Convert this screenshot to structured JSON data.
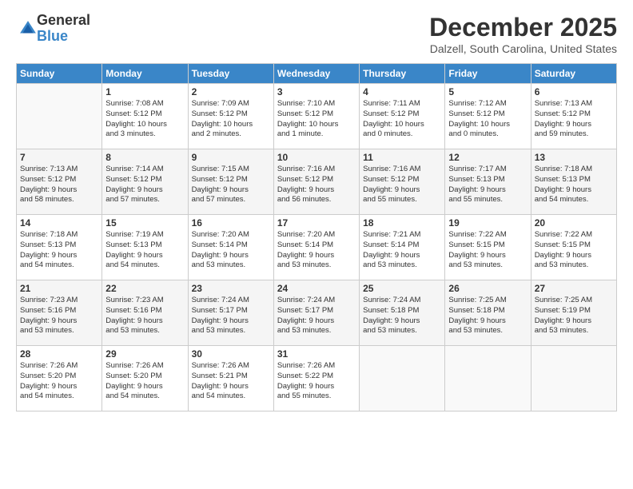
{
  "logo": {
    "general": "General",
    "blue": "Blue"
  },
  "header": {
    "month": "December 2025",
    "location": "Dalzell, South Carolina, United States"
  },
  "weekdays": [
    "Sunday",
    "Monday",
    "Tuesday",
    "Wednesday",
    "Thursday",
    "Friday",
    "Saturday"
  ],
  "weeks": [
    [
      {
        "day": "",
        "info": ""
      },
      {
        "day": "1",
        "info": "Sunrise: 7:08 AM\nSunset: 5:12 PM\nDaylight: 10 hours\nand 3 minutes."
      },
      {
        "day": "2",
        "info": "Sunrise: 7:09 AM\nSunset: 5:12 PM\nDaylight: 10 hours\nand 2 minutes."
      },
      {
        "day": "3",
        "info": "Sunrise: 7:10 AM\nSunset: 5:12 PM\nDaylight: 10 hours\nand 1 minute."
      },
      {
        "day": "4",
        "info": "Sunrise: 7:11 AM\nSunset: 5:12 PM\nDaylight: 10 hours\nand 0 minutes."
      },
      {
        "day": "5",
        "info": "Sunrise: 7:12 AM\nSunset: 5:12 PM\nDaylight: 10 hours\nand 0 minutes."
      },
      {
        "day": "6",
        "info": "Sunrise: 7:13 AM\nSunset: 5:12 PM\nDaylight: 9 hours\nand 59 minutes."
      }
    ],
    [
      {
        "day": "7",
        "info": "Sunrise: 7:13 AM\nSunset: 5:12 PM\nDaylight: 9 hours\nand 58 minutes."
      },
      {
        "day": "8",
        "info": "Sunrise: 7:14 AM\nSunset: 5:12 PM\nDaylight: 9 hours\nand 57 minutes."
      },
      {
        "day": "9",
        "info": "Sunrise: 7:15 AM\nSunset: 5:12 PM\nDaylight: 9 hours\nand 57 minutes."
      },
      {
        "day": "10",
        "info": "Sunrise: 7:16 AM\nSunset: 5:12 PM\nDaylight: 9 hours\nand 56 minutes."
      },
      {
        "day": "11",
        "info": "Sunrise: 7:16 AM\nSunset: 5:12 PM\nDaylight: 9 hours\nand 55 minutes."
      },
      {
        "day": "12",
        "info": "Sunrise: 7:17 AM\nSunset: 5:13 PM\nDaylight: 9 hours\nand 55 minutes."
      },
      {
        "day": "13",
        "info": "Sunrise: 7:18 AM\nSunset: 5:13 PM\nDaylight: 9 hours\nand 54 minutes."
      }
    ],
    [
      {
        "day": "14",
        "info": "Sunrise: 7:18 AM\nSunset: 5:13 PM\nDaylight: 9 hours\nand 54 minutes."
      },
      {
        "day": "15",
        "info": "Sunrise: 7:19 AM\nSunset: 5:13 PM\nDaylight: 9 hours\nand 54 minutes."
      },
      {
        "day": "16",
        "info": "Sunrise: 7:20 AM\nSunset: 5:14 PM\nDaylight: 9 hours\nand 53 minutes."
      },
      {
        "day": "17",
        "info": "Sunrise: 7:20 AM\nSunset: 5:14 PM\nDaylight: 9 hours\nand 53 minutes."
      },
      {
        "day": "18",
        "info": "Sunrise: 7:21 AM\nSunset: 5:14 PM\nDaylight: 9 hours\nand 53 minutes."
      },
      {
        "day": "19",
        "info": "Sunrise: 7:22 AM\nSunset: 5:15 PM\nDaylight: 9 hours\nand 53 minutes."
      },
      {
        "day": "20",
        "info": "Sunrise: 7:22 AM\nSunset: 5:15 PM\nDaylight: 9 hours\nand 53 minutes."
      }
    ],
    [
      {
        "day": "21",
        "info": "Sunrise: 7:23 AM\nSunset: 5:16 PM\nDaylight: 9 hours\nand 53 minutes."
      },
      {
        "day": "22",
        "info": "Sunrise: 7:23 AM\nSunset: 5:16 PM\nDaylight: 9 hours\nand 53 minutes."
      },
      {
        "day": "23",
        "info": "Sunrise: 7:24 AM\nSunset: 5:17 PM\nDaylight: 9 hours\nand 53 minutes."
      },
      {
        "day": "24",
        "info": "Sunrise: 7:24 AM\nSunset: 5:17 PM\nDaylight: 9 hours\nand 53 minutes."
      },
      {
        "day": "25",
        "info": "Sunrise: 7:24 AM\nSunset: 5:18 PM\nDaylight: 9 hours\nand 53 minutes."
      },
      {
        "day": "26",
        "info": "Sunrise: 7:25 AM\nSunset: 5:18 PM\nDaylight: 9 hours\nand 53 minutes."
      },
      {
        "day": "27",
        "info": "Sunrise: 7:25 AM\nSunset: 5:19 PM\nDaylight: 9 hours\nand 53 minutes."
      }
    ],
    [
      {
        "day": "28",
        "info": "Sunrise: 7:26 AM\nSunset: 5:20 PM\nDaylight: 9 hours\nand 54 minutes."
      },
      {
        "day": "29",
        "info": "Sunrise: 7:26 AM\nSunset: 5:20 PM\nDaylight: 9 hours\nand 54 minutes."
      },
      {
        "day": "30",
        "info": "Sunrise: 7:26 AM\nSunset: 5:21 PM\nDaylight: 9 hours\nand 54 minutes."
      },
      {
        "day": "31",
        "info": "Sunrise: 7:26 AM\nSunset: 5:22 PM\nDaylight: 9 hours\nand 55 minutes."
      },
      {
        "day": "",
        "info": ""
      },
      {
        "day": "",
        "info": ""
      },
      {
        "day": "",
        "info": ""
      }
    ]
  ]
}
